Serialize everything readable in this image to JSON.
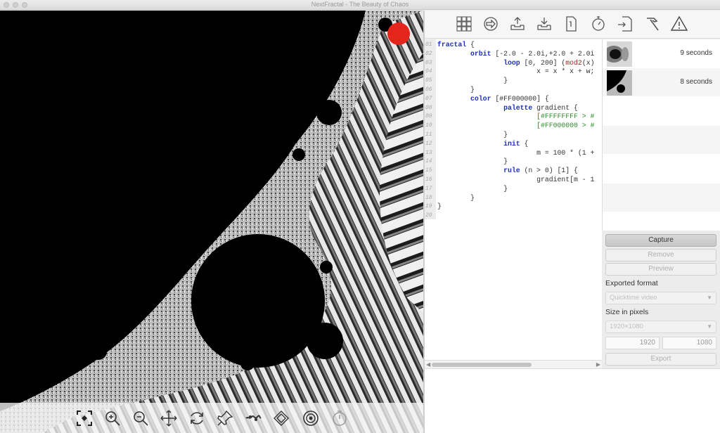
{
  "window": {
    "title": "NextFractal - The Beauty of Chaos"
  },
  "top_toolbar": {
    "tools": [
      "grid-icon",
      "arrow-right-circle-icon",
      "upload-tray-icon",
      "download-tray-icon",
      "document-corner-icon",
      "stopwatch-icon",
      "import-file-icon",
      "hammer-icon",
      "warning-triangle-icon"
    ]
  },
  "editor": {
    "lines": [
      {
        "n": "01",
        "html": "<span class='kw'>fractal</span> {"
      },
      {
        "n": "02",
        "html": "        <span class='kw'>orbit</span> [-2.0 - 2.0i,+2.0 + 2.0i"
      },
      {
        "n": "03",
        "html": "                <span class='kw'>loop</span> [0, 200] (<span class='fn'>mod2</span>(x)"
      },
      {
        "n": "04",
        "html": "                        x = x * x + w;"
      },
      {
        "n": "05",
        "html": "                }"
      },
      {
        "n": "06",
        "html": "        }"
      },
      {
        "n": "07",
        "html": "        <span class='kw'>color</span> [#FF000000] {"
      },
      {
        "n": "08",
        "html": "                <span class='kw'>palette</span> gradient {"
      },
      {
        "n": "09",
        "html": "                        <span class='str'>[#FFFFFFFF &gt; #</span>"
      },
      {
        "n": "10",
        "html": "                        <span class='str'>[#FF000000 &gt; #</span>"
      },
      {
        "n": "11",
        "html": "                }"
      },
      {
        "n": "12",
        "html": "                <span class='kw'>init</span> {"
      },
      {
        "n": "13",
        "html": "                        m = 100 * (1 +"
      },
      {
        "n": "14",
        "html": "                }"
      },
      {
        "n": "15",
        "html": "                <span class='kw'>rule</span> (n &gt; 0) [1] {"
      },
      {
        "n": "16",
        "html": "                        gradient[m - 1"
      },
      {
        "n": "17",
        "html": "                }"
      },
      {
        "n": "18",
        "html": "        }"
      },
      {
        "n": "19",
        "html": "}"
      },
      {
        "n": "20",
        "html": ""
      }
    ]
  },
  "jobs": [
    {
      "label": "9 seconds"
    },
    {
      "label": "8 seconds"
    }
  ],
  "controls": {
    "capture": "Capture",
    "remove": "Remove",
    "preview": "Preview",
    "exported_format_label": "Exported format",
    "format_value": "Quicktime video",
    "size_label": "Size in pixels",
    "size_value": "1920×1080",
    "width": "1920",
    "height": "1080",
    "export": "Export"
  },
  "bottom_toolbar": {
    "tools": [
      "select-region-icon",
      "zoom-in-icon",
      "zoom-out-icon",
      "move-icon",
      "rotate-icon",
      "pin-icon",
      "julia-icon",
      "orbit-icon",
      "capture-icon",
      "timer-icon"
    ]
  },
  "colors": {
    "record_dot": "#e3251b",
    "keyword": "#1a2fbf",
    "function": "#a3241f",
    "string": "#2e8b2e"
  }
}
